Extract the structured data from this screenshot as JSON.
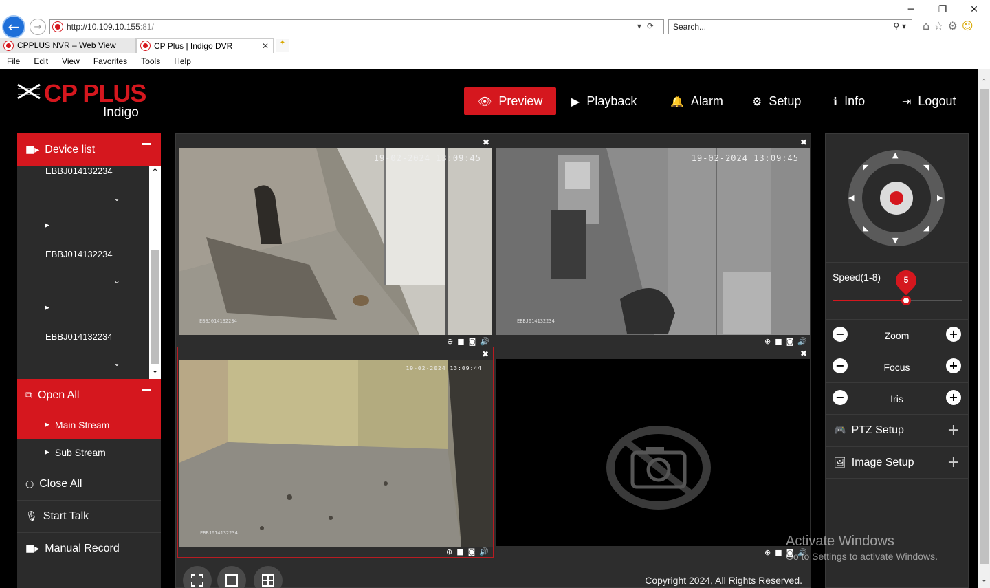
{
  "browser": {
    "url_host": "http://10.109.10.155",
    "url_port": ":81/",
    "search_placeholder": "Search...",
    "tabs": [
      {
        "label": "CPPLUS NVR – Web View"
      },
      {
        "label": "CP Plus | Indigo DVR"
      }
    ],
    "menu": [
      "File",
      "Edit",
      "View",
      "Favorites",
      "Tools",
      "Help"
    ]
  },
  "app": {
    "logo_text": "CP PLUS",
    "logo_sub": "Indigo",
    "brand_color": "#d5171e",
    "nav": [
      {
        "label": "Preview",
        "icon": "eye-icon"
      },
      {
        "label": "Playback",
        "icon": "play-icon"
      },
      {
        "label": "Alarm",
        "icon": "bell-icon"
      },
      {
        "label": "Setup",
        "icon": "gear-icon"
      },
      {
        "label": "Info",
        "icon": "info-icon"
      },
      {
        "label": "Logout",
        "icon": "logout-icon"
      }
    ]
  },
  "sidebar": {
    "device_list_label": "Device list",
    "devices": [
      "EBBJ014132234",
      "EBBJ014132234",
      "EBBJ014132234"
    ],
    "open_all_label": "Open All",
    "main_stream_label": "Main Stream",
    "sub_stream_label": "Sub Stream",
    "close_all_label": "Close All",
    "start_talk_label": "Start Talk",
    "manual_record_label": "Manual Record"
  },
  "cameras": [
    {
      "timestamp": "19-02-2024 13:09:45",
      "label": "EBBJ014132234"
    },
    {
      "timestamp": "19-02-2024 13:09:45",
      "label": "EBBJ014132234"
    },
    {
      "timestamp": "19-02-2024 13:09:44",
      "label": "EBBJ014132234"
    },
    {
      "timestamp": "",
      "label": ""
    }
  ],
  "footer": {
    "copyright": "Copyright 2024, All Rights Reserved."
  },
  "ptz": {
    "speed_label": "Speed(1-8)",
    "speed_value": "5",
    "speed_fraction": 0.57,
    "zoom_label": "Zoom",
    "focus_label": "Focus",
    "iris_label": "Iris",
    "ptz_setup_label": "PTZ Setup",
    "image_setup_label": "Image Setup"
  },
  "watermark": {
    "line1": "Activate Windows",
    "line2": "Go to Settings to activate Windows."
  }
}
